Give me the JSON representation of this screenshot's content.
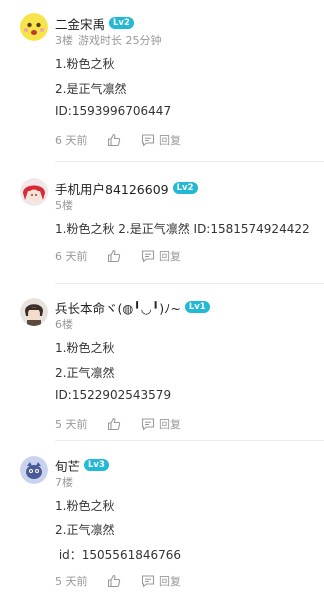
{
  "comments": [
    {
      "username": "二金宋禹",
      "level": "Lv2",
      "floor": "3楼",
      "playtime": "游戏时长 25分钟",
      "lines": [
        "1.粉色之秋",
        "2.是正气凛然",
        "ID:1593996706447"
      ],
      "time": "6 天前",
      "reply": "回复"
    },
    {
      "username": "手机用户84126609",
      "level": "Lv2",
      "floor": "5楼",
      "lines": [
        "1.粉色之秋 2.是正气凛然 ID:1581574924422"
      ],
      "time": "6 天前",
      "reply": "回复"
    },
    {
      "username": "兵长本命ヾ(◍╹◡╹)ﾉ~",
      "level": "Lv1",
      "floor": "6楼",
      "lines": [
        "1.粉色之秋",
        "2.正气凛然",
        "ID:1522902543579"
      ],
      "time": "5 天前",
      "reply": "回复"
    },
    {
      "username": "旬芒",
      "level": "Lv3",
      "floor": "7楼",
      "lines": [
        "1.粉色之秋",
        "2.正气凛然",
        " id：1505561846766"
      ],
      "time": "5 天前",
      "reply": "回复"
    }
  ],
  "colors": {
    "level_badge": "#22b8d6",
    "meta_text": "#999999",
    "divider": "#ececec"
  },
  "icons": {
    "like": "thumbs-up-icon",
    "reply": "comment-bubble-icon"
  }
}
